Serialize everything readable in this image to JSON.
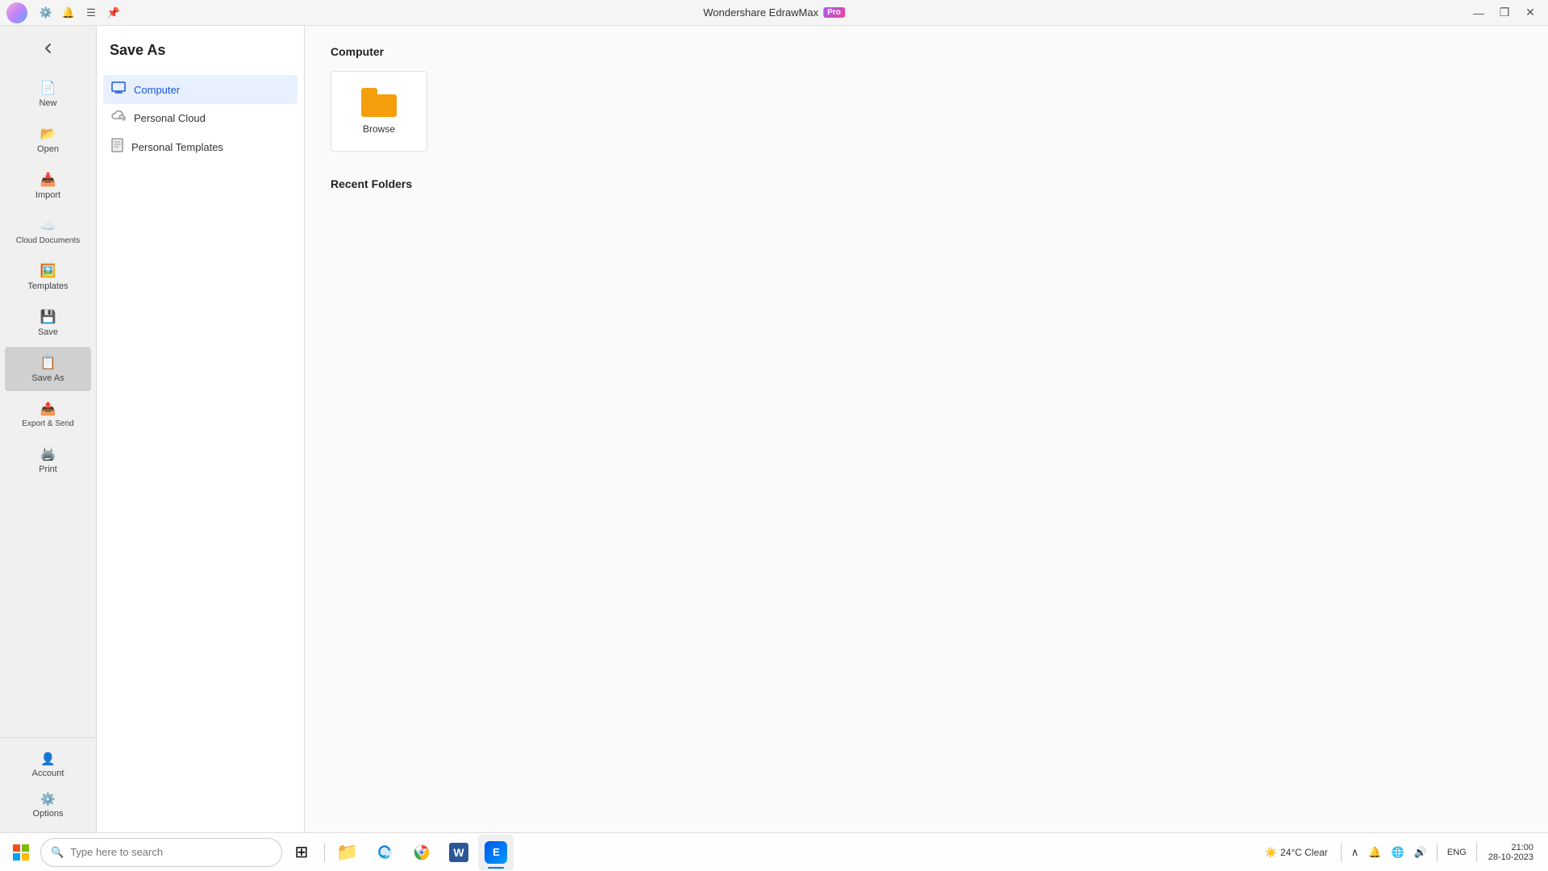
{
  "titleBar": {
    "appName": "Wondershare EdrawMax",
    "proBadge": "Pro",
    "buttons": {
      "minimize": "—",
      "restore": "❐",
      "close": "✕"
    }
  },
  "sidebarNarrow": {
    "items": [
      {
        "id": "new",
        "label": "New",
        "icon": "📄"
      },
      {
        "id": "open",
        "label": "Open",
        "icon": "📂"
      },
      {
        "id": "import",
        "label": "Import",
        "icon": "📥"
      },
      {
        "id": "cloud",
        "label": "Cloud Documents",
        "icon": "☁"
      },
      {
        "id": "templates",
        "label": "Templates",
        "icon": "🖼"
      },
      {
        "id": "save",
        "label": "Save",
        "icon": "💾"
      },
      {
        "id": "saveas",
        "label": "Save As",
        "icon": "📋",
        "active": true
      },
      {
        "id": "export",
        "label": "Export & Send",
        "icon": "📤"
      },
      {
        "id": "print",
        "label": "Print",
        "icon": "🖨"
      }
    ],
    "bottomItems": [
      {
        "id": "account",
        "label": "Account",
        "icon": "👤"
      },
      {
        "id": "options",
        "label": "Options",
        "icon": "⚙"
      }
    ]
  },
  "saveAsPanel": {
    "title": "Save As",
    "items": [
      {
        "id": "computer",
        "label": "Computer",
        "icon": "💻",
        "active": true
      },
      {
        "id": "personalCloud",
        "label": "Personal Cloud",
        "icon": "☁"
      },
      {
        "id": "personalTemplates",
        "label": "Personal Templates",
        "icon": "📄"
      }
    ]
  },
  "mainContent": {
    "sectionTitle": "Computer",
    "browseCard": {
      "label": "Browse"
    },
    "recentFoldersTitle": "Recent Folders"
  },
  "taskbar": {
    "searchPlaceholder": "Type here to search",
    "weather": "24°C  Clear",
    "time": "21:00",
    "date": "28-10-2023",
    "language": "ENG",
    "apps": [
      {
        "id": "windows-start",
        "type": "start"
      },
      {
        "id": "search",
        "type": "search"
      },
      {
        "id": "task-view",
        "icon": "⊞"
      },
      {
        "id": "file-explorer",
        "icon": "📁"
      },
      {
        "id": "edge",
        "icon": "🌐"
      },
      {
        "id": "chrome",
        "icon": "●"
      },
      {
        "id": "word",
        "icon": "W"
      },
      {
        "id": "edraw",
        "icon": "E"
      }
    ],
    "sysIcons": [
      "🔼",
      "🔔",
      "🌐",
      "🔊"
    ]
  }
}
